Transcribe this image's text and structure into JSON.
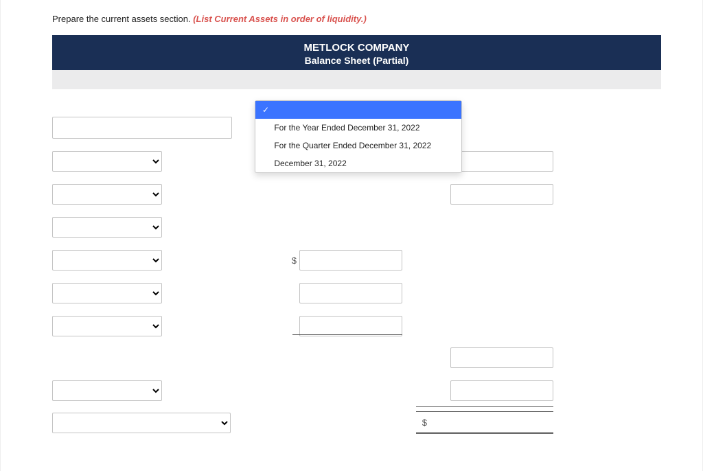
{
  "prompt": {
    "text": "Prepare the current assets section. ",
    "hint": "(List Current Assets in order of liquidity.)"
  },
  "header": {
    "company": "METLOCK COMPANY",
    "statement": "Balance Sheet (Partial)"
  },
  "date_dropdown": {
    "options": [
      "",
      "For the Year Ended December 31, 2022",
      "For the Quarter Ended December 31, 2022",
      "December 31, 2022"
    ],
    "check_glyph": "✓"
  },
  "currency_symbol": "$"
}
